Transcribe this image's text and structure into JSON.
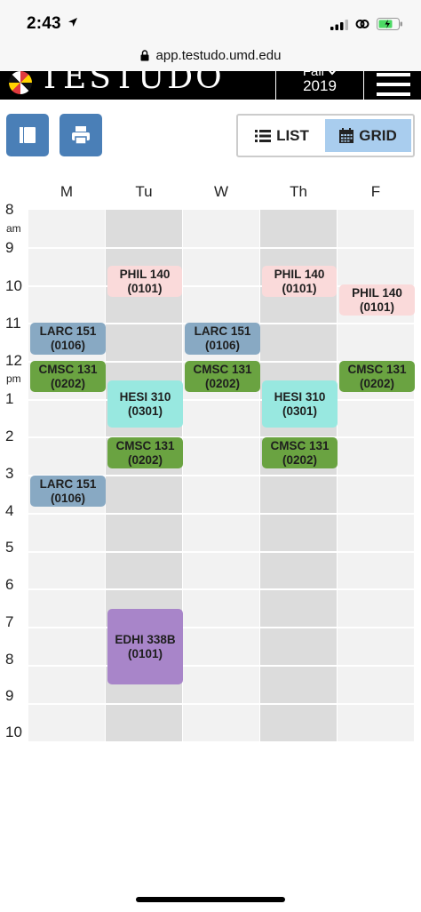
{
  "status_bar": {
    "time": "2:43"
  },
  "browser": {
    "url": "app.testudo.umd.edu"
  },
  "header": {
    "logo_text": "TESTUDO",
    "term_season": "Fall",
    "term_year": "2019"
  },
  "view_toggle": {
    "list_label": "LIST",
    "grid_label": "GRID",
    "selected": "GRID"
  },
  "schedule": {
    "days": [
      "M",
      "Tu",
      "W",
      "Th",
      "F"
    ],
    "hours": [
      "8",
      "9",
      "10",
      "11",
      "12",
      "1",
      "2",
      "3",
      "4",
      "5",
      "6",
      "7",
      "8",
      "9",
      "10"
    ],
    "am_label": "am",
    "pm_label": "pm",
    "events": [
      {
        "course": "PHIL 140",
        "section": "(0101)",
        "day": "Tu",
        "start": "10:00",
        "end": "10:50"
      },
      {
        "course": "PHIL 140",
        "section": "(0101)",
        "day": "Th",
        "start": "10:00",
        "end": "10:50"
      },
      {
        "course": "PHIL 140",
        "section": "(0101)",
        "day": "F",
        "start": "10:00",
        "end": "10:50"
      },
      {
        "course": "LARC 151",
        "section": "(0106)",
        "day": "M",
        "start": "12:00",
        "end": "12:50"
      },
      {
        "course": "LARC 151",
        "section": "(0106)",
        "day": "W",
        "start": "12:00",
        "end": "12:50"
      },
      {
        "course": "CMSC 131",
        "section": "(0202)",
        "day": "M",
        "start": "1:00",
        "end": "1:50"
      },
      {
        "course": "CMSC 131",
        "section": "(0202)",
        "day": "W",
        "start": "1:00",
        "end": "1:50"
      },
      {
        "course": "CMSC 131",
        "section": "(0202)",
        "day": "F",
        "start": "1:00",
        "end": "1:50"
      },
      {
        "course": "HESI 310",
        "section": "(0301)",
        "day": "Tu",
        "start": "1:30",
        "end": "2:45"
      },
      {
        "course": "HESI 310",
        "section": "(0301)",
        "day": "Th",
        "start": "1:30",
        "end": "2:45"
      },
      {
        "course": "CMSC 131",
        "section": "(0202)",
        "day": "Tu",
        "start": "3:00",
        "end": "3:50"
      },
      {
        "course": "CMSC 131",
        "section": "(0202)",
        "day": "Th",
        "start": "3:00",
        "end": "3:50"
      },
      {
        "course": "LARC 151",
        "section": "(0106)",
        "day": "M",
        "start": "4:00",
        "end": "4:50"
      },
      {
        "course": "EDHI 338B",
        "section": "(0101)",
        "day": "Tu",
        "start": "7:00",
        "end": "9:00"
      }
    ]
  },
  "colors": {
    "LARC": "#88a9c3",
    "CMSC": "#6aa341",
    "PHIL": "#fadada",
    "HESI": "#98e8e0",
    "EDHI": "#a885c9",
    "toolbar_button": "#4a7fb7",
    "grid_selected": "#a9cdee"
  },
  "icons": {
    "toolbar_left": "book-icon",
    "toolbar_right": "print-icon",
    "list": "list-icon",
    "grid": "calendar-icon"
  }
}
